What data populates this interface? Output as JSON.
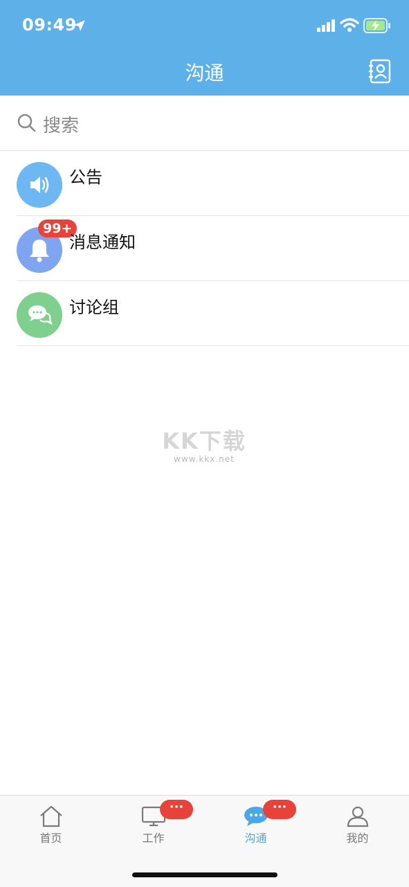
{
  "status": {
    "time": "09:49"
  },
  "header": {
    "title": "沟通"
  },
  "search": {
    "placeholder": "搜索"
  },
  "list": [
    {
      "label": "公告",
      "icon": "speaker-icon",
      "color": "#6db7f2"
    },
    {
      "label": "消息通知",
      "icon": "bell-icon",
      "color": "#7fa4f0",
      "badge": "99+"
    },
    {
      "label": "讨论组",
      "icon": "chat-bubbles-icon",
      "color": "#7fcf8e"
    }
  ],
  "watermark": {
    "main": "KK下载",
    "url": "www.kkx.net"
  },
  "tabs": [
    {
      "label": "首页",
      "icon": "home-icon"
    },
    {
      "label": "工作",
      "icon": "monitor-icon",
      "badge": "···"
    },
    {
      "label": "沟通",
      "icon": "chat-icon",
      "badge": "···",
      "active": true
    },
    {
      "label": "我的",
      "icon": "person-icon"
    }
  ],
  "colors": {
    "header": "#5eb0e8",
    "badge": "#e8433a",
    "active_tab": "#4aa8e6"
  }
}
